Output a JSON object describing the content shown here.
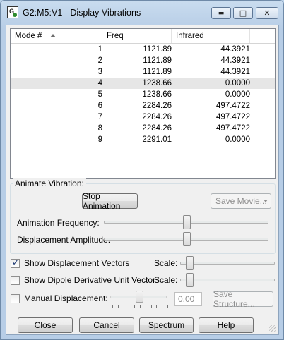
{
  "window": {
    "title": "G2:M5:V1 - Display Vibrations"
  },
  "titlebar_buttons": {
    "minimize": "▭",
    "maximize": "□",
    "close": "✕"
  },
  "table": {
    "columns": [
      "Mode #",
      "Freq",
      "Infrared"
    ],
    "rows": [
      {
        "mode": "1",
        "freq": "1121.89",
        "ir": "44.3921"
      },
      {
        "mode": "2",
        "freq": "1121.89",
        "ir": "44.3921"
      },
      {
        "mode": "3",
        "freq": "1121.89",
        "ir": "44.3921"
      },
      {
        "mode": "4",
        "freq": "1238.66",
        "ir": "0.0000"
      },
      {
        "mode": "5",
        "freq": "1238.66",
        "ir": "0.0000"
      },
      {
        "mode": "6",
        "freq": "2284.26",
        "ir": "497.4722"
      },
      {
        "mode": "7",
        "freq": "2284.26",
        "ir": "497.4722"
      },
      {
        "mode": "8",
        "freq": "2284.26",
        "ir": "497.4722"
      },
      {
        "mode": "9",
        "freq": "2291.01",
        "ir": "0.0000"
      }
    ],
    "selected_mode": "4"
  },
  "animate": {
    "group_label": "Animate Vibration:",
    "stop_button": "Stop Animation",
    "save_movie_button": "Save Movie...",
    "frequency_label": "Animation Frequency:",
    "frequency_level": 0.5,
    "amplitude_label": "Displacement Amplitude:",
    "amplitude_level": 0.5
  },
  "options": {
    "show_vectors_label": "Show Displacement Vectors",
    "show_vectors_checked": true,
    "vectors_scale_label": "Scale:",
    "show_dipole_label": "Show Dipole Derivative Unit Vector",
    "show_dipole_checked": false,
    "dipole_scale_label": "Scale:",
    "manual_label": "Manual Displacement:",
    "manual_checked": false,
    "manual_value": "0.00",
    "save_structure_button": "Save Structure..."
  },
  "footer": {
    "close": "Close",
    "cancel": "Cancel",
    "spectrum": "Spectrum",
    "help": "Help"
  }
}
